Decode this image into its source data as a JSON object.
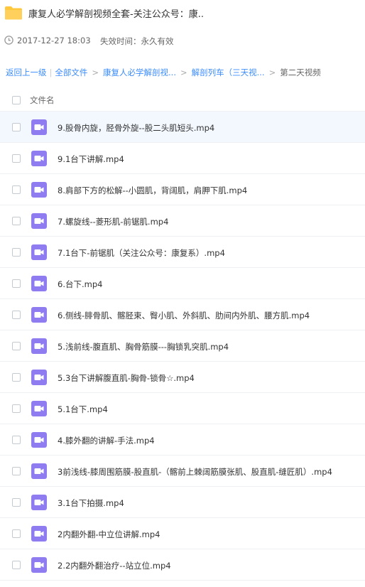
{
  "header": {
    "title": "康复人必学解剖视频全套-关注公众号：康..",
    "date": "2017-12-27 18:03",
    "expire_label": "失效时间：永久有效"
  },
  "breadcrumb": {
    "back": "返回上一级",
    "all_files": "全部文件",
    "crumb1": "康复人必学解剖视...",
    "crumb2": "解剖列车（三天视...",
    "current": "第二天视频"
  },
  "columns": {
    "name": "文件名"
  },
  "files": [
    "9.股骨内旋，胫骨外旋--股二头肌短头.mp4",
    "9.1台下讲解.mp4",
    "8.肩部下方的松解--小圆肌，背阔肌，肩胛下肌.mp4",
    "7.螺旋线--菱形肌-前锯肌.mp4",
    "7.1台下-前锯肌（关注公众号：康复系）.mp4",
    "6.台下.mp4",
    "6.侧线-腓骨肌、髂胫束、臀小肌、外斜肌、肋间内外肌、腰方肌.mp4",
    "5.浅前线-腹直肌、胸骨筋膜---胸锁乳突肌.mp4",
    "5.3台下讲解腹直肌-胸骨-锁骨☆.mp4",
    "5.1台下.mp4",
    "4.膝外翻的讲解-手法.mp4",
    "3前浅线-膝周围筋膜-股直肌-（髂前上棘阔筋膜张肌、股直肌-缝匠肌）.mp4",
    "3.1台下拍摄.mp4",
    "2内翻外翻-中立位讲解.mp4",
    "2.2内翻外翻治疗--站立位.mp4"
  ],
  "colors": {
    "link": "#3b8cff",
    "folder": "#ffc83d",
    "video": "#8e7cf0"
  }
}
